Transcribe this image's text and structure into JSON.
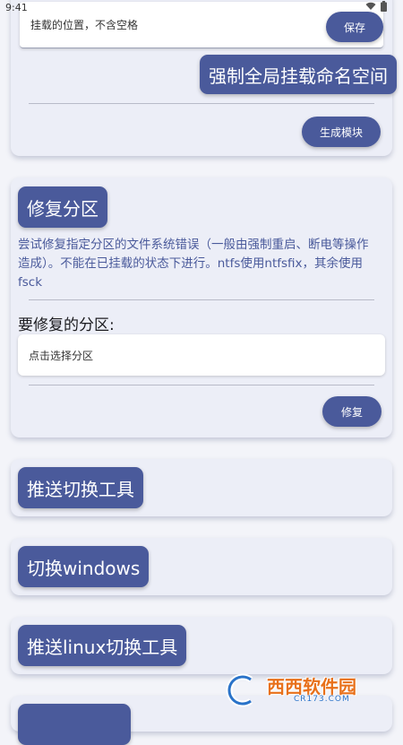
{
  "status_bar": {
    "time": "9:41"
  },
  "mount_card": {
    "mount_input_placeholder": "挂载的位置，不含空格",
    "save_label": "保存",
    "force_global_label": "强制全局挂载命名空间",
    "generate_module_label": "生成模块"
  },
  "repair_card": {
    "title": "修复分区",
    "description": "尝试修复指定分区的文件系统错误（一般由强制重启、断电等操作造成）。不能在已挂载的状态下进行。ntfs使用ntfsfix，其余使用fsck",
    "partition_label": "要修复的分区:",
    "partition_select": "点击选择分区",
    "repair_label": "修复"
  },
  "push_switch_tool": {
    "label": "推送切换工具"
  },
  "switch_windows": {
    "label": "切换windows"
  },
  "push_linux_tool": {
    "label": "推送linux切换工具"
  },
  "watermark": {
    "brand": "西西软件园",
    "domain": "CR173.COM"
  },
  "colors": {
    "accent": "#4a5a9b",
    "card": "#eceef7",
    "background": "#f3f4f9"
  },
  "icons": [
    "wifi-icon",
    "battery-icon"
  ]
}
